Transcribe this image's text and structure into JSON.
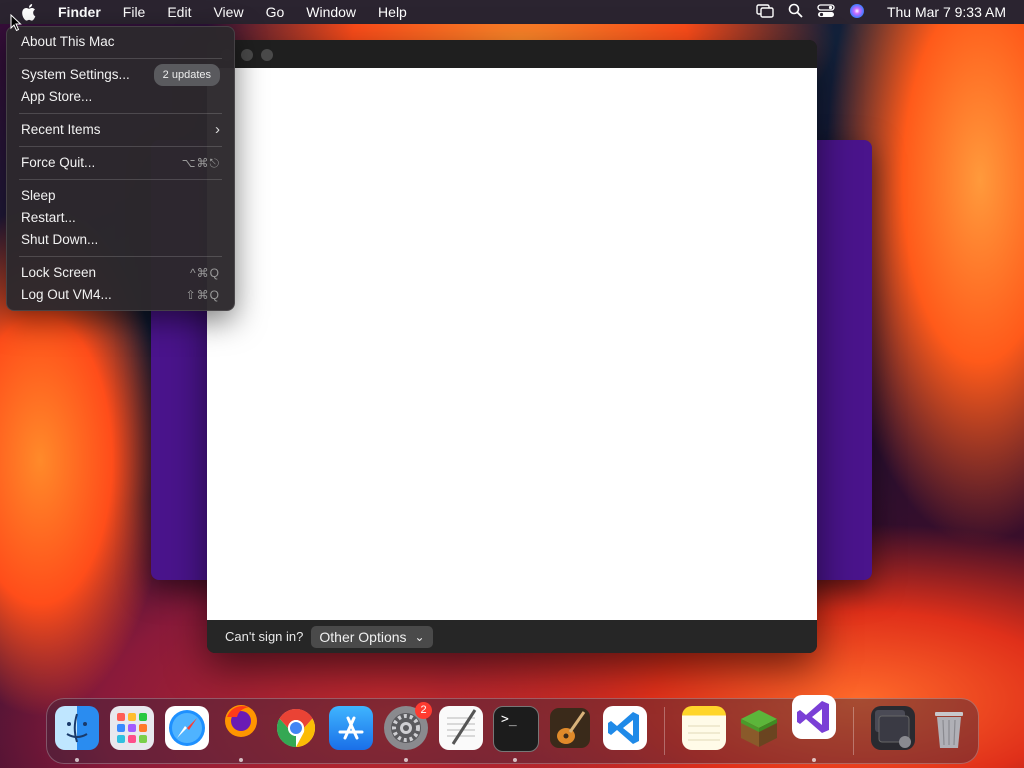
{
  "menubar": {
    "app_name": "Finder",
    "menus": [
      "File",
      "Edit",
      "View",
      "Go",
      "Window",
      "Help"
    ],
    "clock": "Thu Mar 7  9:33 AM",
    "status_icons": [
      "screen-mirroring-icon",
      "search-icon",
      "control-center-icon",
      "siri-icon"
    ]
  },
  "apple_menu": {
    "about": "About This Mac",
    "system_settings": "System Settings...",
    "updates_badge": "2 updates",
    "app_store": "App Store...",
    "recent_items": "Recent Items",
    "recent_chevron": "›",
    "force_quit": "Force Quit...",
    "force_quit_shortcut": "⌥⌘⎋",
    "sleep": "Sleep",
    "restart": "Restart...",
    "shut_down": "Shut Down...",
    "lock_screen": "Lock Screen",
    "lock_screen_shortcut": "^⌘Q",
    "log_out": "Log Out VM4...",
    "log_out_shortcut": "⇧⌘Q"
  },
  "login_window": {
    "cant_sign_in": "Can't sign in?",
    "other_options": "Other Options",
    "chevron": "⌄"
  },
  "dock": {
    "apps": [
      "Finder",
      "Launchpad",
      "Safari",
      "Firefox",
      "Google Chrome",
      "App Store",
      "System Settings",
      "TextEdit",
      "Terminal",
      "GarageBand",
      "Visual Studio Code",
      "Notes",
      "Minecraft",
      "Visual Studio",
      "Downloads",
      "Trash"
    ],
    "settings_badge": "2",
    "terminal_glyph": ">_"
  },
  "colors": {
    "menubar_bg": "#2b2430",
    "menu_bg": "#2c282c",
    "purple_window": "#4a148c"
  }
}
